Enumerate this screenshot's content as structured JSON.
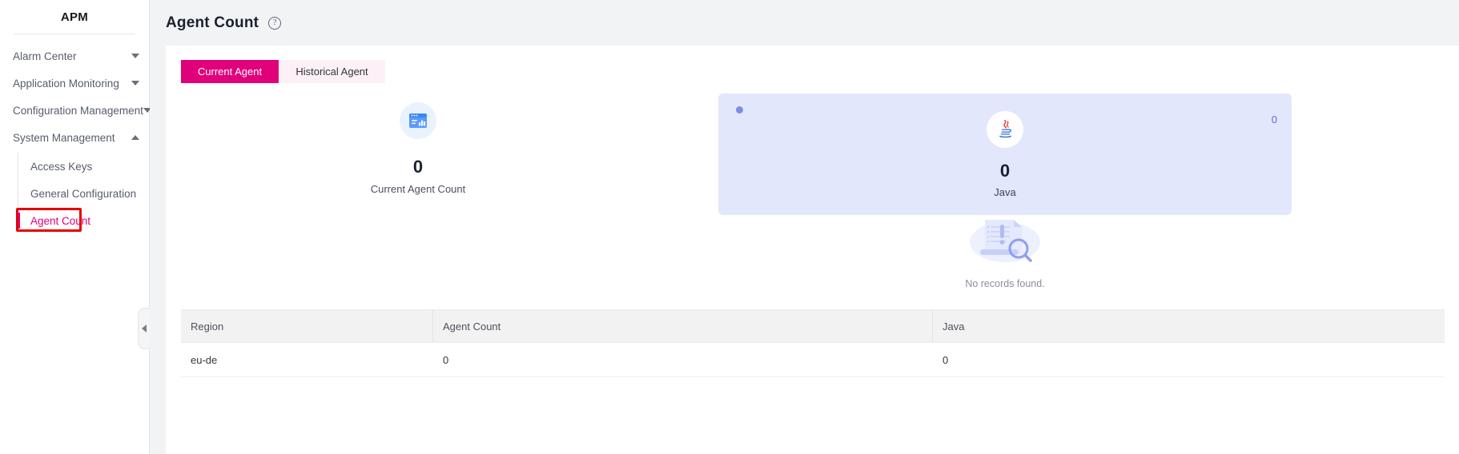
{
  "sidebar": {
    "title": "APM",
    "items": [
      {
        "label": "Alarm Center",
        "caret": "chevron-down-icon"
      },
      {
        "label": "Application Monitoring",
        "caret": "chevron-down-icon"
      },
      {
        "label": "Configuration Management",
        "caret": "chevron-down-icon"
      },
      {
        "label": "System Management",
        "caret": "chevron-up-icon"
      }
    ],
    "subitems": [
      {
        "label": "Access Keys",
        "active": false
      },
      {
        "label": "General Configuration",
        "active": false
      },
      {
        "label": "Agent Count",
        "active": true
      }
    ],
    "collapse_handle": "collapse-sidebar-arrow",
    "annotation_color": "#e60000",
    "active_color": "#e0007a"
  },
  "header": {
    "title": "Agent Count",
    "help_icon": "help-circle-icon"
  },
  "tabs": [
    {
      "label": "Current Agent",
      "active": true
    },
    {
      "label": "Historical Agent",
      "active": false
    }
  ],
  "summary": {
    "agent_total": {
      "icon": "dashboard-window-icon",
      "value": "0",
      "label": "Current Agent Count"
    },
    "language_card": {
      "icon": "java-coffee-cup-icon",
      "value": "0",
      "label": "Java",
      "corner_value": "0",
      "bg_color": "#e3e7fc",
      "dot_color": "#7b8ee0"
    }
  },
  "empty_state": {
    "icon": "no-records-document-search-icon",
    "text": "No records found."
  },
  "table": {
    "columns": [
      "Region",
      "Agent Count",
      "Java"
    ],
    "rows": [
      {
        "region": "eu-de",
        "agent_count": "0",
        "java": "0"
      }
    ]
  }
}
